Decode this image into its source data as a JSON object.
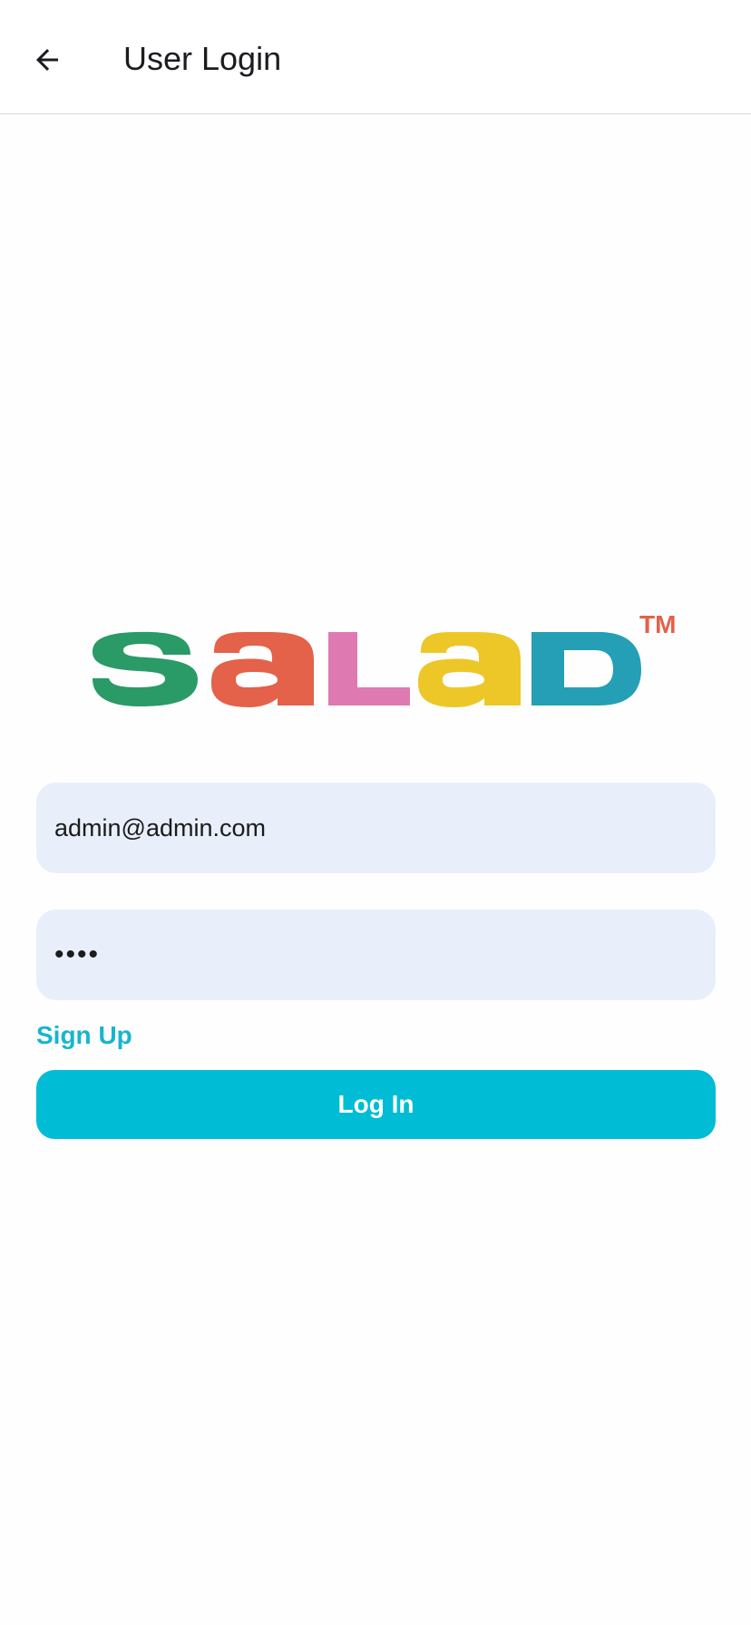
{
  "header": {
    "title": "User Login",
    "back_icon": "arrow-back-icon"
  },
  "logo": {
    "text": "SALAD",
    "trademark": "TM",
    "colors": {
      "s": "#2a9a67",
      "a1": "#e4614a",
      "l": "#df79b2",
      "a2": "#edc728",
      "d": "#249fb5",
      "tm": "#e4614a"
    }
  },
  "form": {
    "email_value": "admin@admin.com",
    "password_value": "••••",
    "signup_label": "Sign Up",
    "login_label": "Log In"
  },
  "colors": {
    "accent": "#00bcd4",
    "link": "#17b5cf",
    "field_bg": "#e8effb"
  }
}
